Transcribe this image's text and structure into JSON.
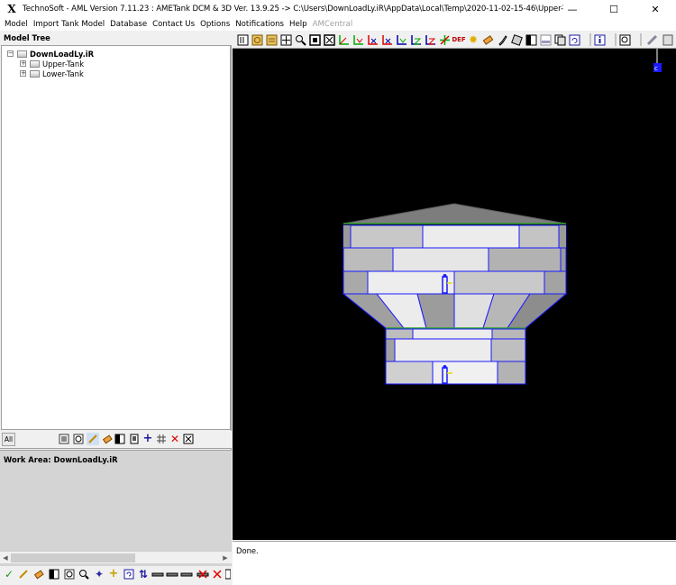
{
  "window": {
    "title": "TechnoSoft - AML Version 7.11.23 : AMETank DCM & 3D Ver. 13.9.25 -> C:\\Users\\DownLoadLy.iR\\AppData\\Local\\Temp\\2020-11-02-15-46\\Upper-Tank\\Design Details\\Models\\Upper-T...",
    "logo_glyph": "X",
    "minimize_glyph": "—",
    "maximize_glyph": "☐",
    "close_glyph": "✕"
  },
  "menu": {
    "items": [
      {
        "label": "Model",
        "enabled": true
      },
      {
        "label": "Import Tank Model",
        "enabled": true
      },
      {
        "label": "Database",
        "enabled": true
      },
      {
        "label": "Contact Us",
        "enabled": true
      },
      {
        "label": "Options",
        "enabled": true
      },
      {
        "label": "Notifications",
        "enabled": true
      },
      {
        "label": "Help",
        "enabled": true
      },
      {
        "label": "AMCentral",
        "enabled": false
      }
    ]
  },
  "model_tree": {
    "header": "Model Tree",
    "root": {
      "label": "DownLoadLy.iR",
      "expander": "⊟"
    },
    "children": [
      {
        "label": "Upper-Tank",
        "expander": "⊞"
      },
      {
        "label": "Lower-Tank",
        "expander": "⊞"
      }
    ],
    "toolbar": {
      "all_label": "All",
      "icons": [
        "frame-icon",
        "zoom-frame-icon",
        "pencil-icon",
        "eraser-icon",
        "split-view-icon",
        "page-icon",
        "add-icon",
        "grid-icon",
        "delete-icon",
        "fit-icon"
      ]
    }
  },
  "work_area": {
    "label": "Work Area: DownLoadLy.iR"
  },
  "bottom_toolbar": {
    "icons": [
      "check-icon",
      "pencil-icon",
      "eraser-icon",
      "split-view-icon",
      "zoom-icon",
      "compass-icon",
      "add-icon",
      "refresh-icon",
      "sort-icon",
      "line-icon",
      "line-icon",
      "line-icon",
      "remove-line-icon",
      "cross-icon",
      "more-icon"
    ]
  },
  "viewer_toolbar": {
    "def_label": "DEF",
    "icons": [
      "select-icon",
      "layers-icon",
      "layers-icon",
      "pan-icon",
      "zoom-icon",
      "zoom-window-icon",
      "fit-icon",
      "view-xy-icon",
      "view-yz-icon",
      "view-xz-icon",
      "view-yx-icon",
      "view-zy-icon",
      "view-zx-icon",
      "axes-icon",
      "def-icon",
      "light-icon",
      "eraser-icon",
      "brush-icon",
      "material-icon",
      "shade-icon",
      "wireframe-icon",
      "copy-icon",
      "rotate-icon",
      "info-icon",
      "preview-icon",
      "ruler-icon",
      "cut-icon"
    ]
  },
  "status": {
    "text": "Done."
  },
  "colors": {
    "viewport_bg": "#000000",
    "wire_blue": "#1a1aff",
    "plate_light": "#e6e6e6",
    "plate_mid": "#b8b8b8",
    "roof": "#7a7a7a"
  }
}
